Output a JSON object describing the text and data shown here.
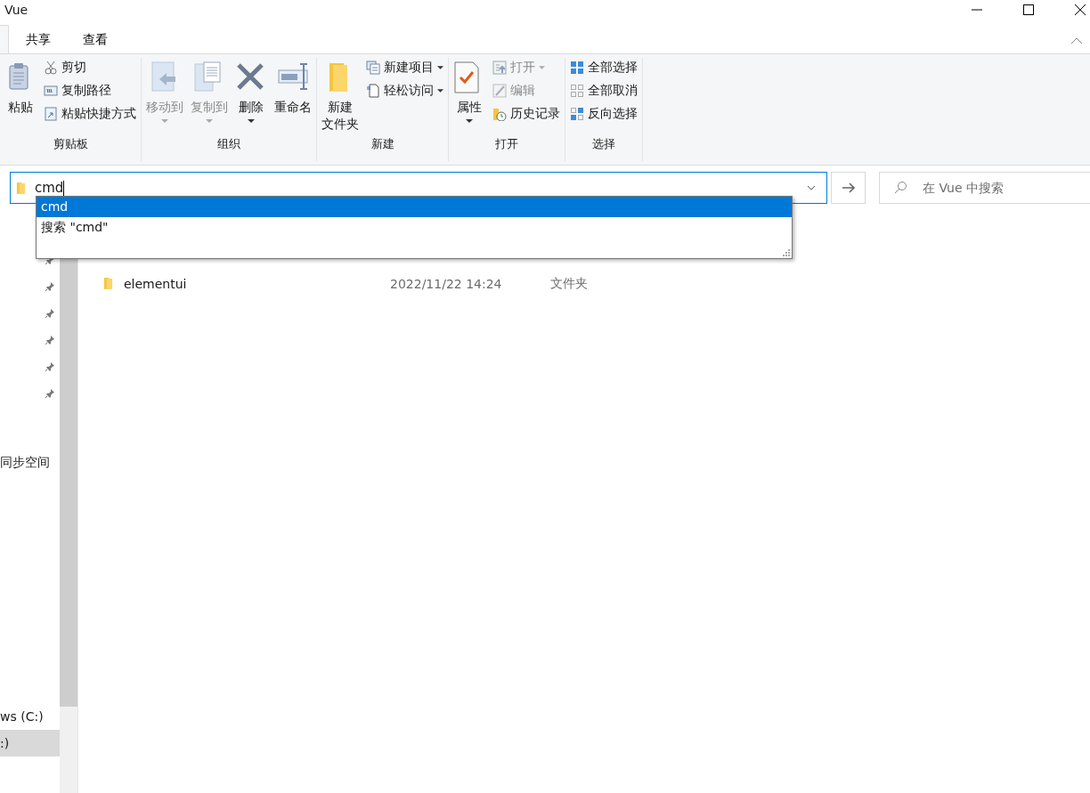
{
  "window": {
    "title": "Vue"
  },
  "ribbon_tabs": [
    {
      "label": "共享"
    },
    {
      "label": "查看"
    }
  ],
  "ribbon_groups": [
    {
      "label": "剪贴板",
      "items": [
        {
          "kind": "large",
          "lines": [
            "粘贴"
          ],
          "disabled": false,
          "dropdown": false
        },
        {
          "kind": "small",
          "lines": [
            "剪切"
          ],
          "disabled": false,
          "dropdown": false
        },
        {
          "kind": "small",
          "lines": [
            "复制路径"
          ],
          "disabled": false,
          "dropdown": false
        },
        {
          "kind": "small",
          "lines": [
            "粘贴快捷方式"
          ],
          "disabled": false,
          "dropdown": false
        }
      ]
    },
    {
      "label": "组织",
      "items": [
        {
          "kind": "large",
          "lines": [
            "移动到"
          ],
          "disabled": true,
          "dropdown": true
        },
        {
          "kind": "large",
          "lines": [
            "复制到"
          ],
          "disabled": true,
          "dropdown": true
        },
        {
          "kind": "large",
          "lines": [
            "删除"
          ],
          "disabled": false,
          "dropdown": true
        },
        {
          "kind": "large",
          "lines": [
            "重命名"
          ],
          "disabled": false,
          "dropdown": false
        }
      ]
    },
    {
      "label": "新建",
      "items": [
        {
          "kind": "large",
          "lines": [
            "新建",
            "文件夹"
          ],
          "disabled": false,
          "dropdown": false
        },
        {
          "kind": "small",
          "lines": [
            "新建项目"
          ],
          "disabled": false,
          "dropdown": true
        },
        {
          "kind": "small",
          "lines": [
            "轻松访问"
          ],
          "disabled": false,
          "dropdown": true
        }
      ]
    },
    {
      "label": "打开",
      "items": [
        {
          "kind": "large",
          "lines": [
            "属性"
          ],
          "disabled": false,
          "dropdown": true
        },
        {
          "kind": "small",
          "lines": [
            "打开"
          ],
          "disabled": true,
          "dropdown": true
        },
        {
          "kind": "small",
          "lines": [
            "编辑"
          ],
          "disabled": true,
          "dropdown": false
        },
        {
          "kind": "small",
          "lines": [
            "历史记录"
          ],
          "disabled": false,
          "dropdown": false
        }
      ]
    },
    {
      "label": "选择",
      "items": [
        {
          "kind": "small",
          "lines": [
            "全部选择"
          ],
          "disabled": false,
          "dropdown": false
        },
        {
          "kind": "small",
          "lines": [
            "全部取消"
          ],
          "disabled": false,
          "dropdown": false
        },
        {
          "kind": "small",
          "lines": [
            "反向选择"
          ],
          "disabled": false,
          "dropdown": false
        }
      ]
    }
  ],
  "address_bar": {
    "value": "cmd"
  },
  "search": {
    "placeholder": "在 Vue 中搜索"
  },
  "suggestions": [
    {
      "label": "cmd",
      "selected": true
    },
    {
      "label": "搜索 \"cmd\"",
      "selected": false
    }
  ],
  "sidebar": {
    "items": [
      {
        "label": "同步空间",
        "selected": false
      },
      {
        "label": "ws (C:)",
        "selected": false
      },
      {
        "label": ":)",
        "selected": true
      }
    ]
  },
  "files": [
    {
      "name": "elementui",
      "date": "2022/11/22 14:24",
      "type": "文件夹"
    }
  ]
}
